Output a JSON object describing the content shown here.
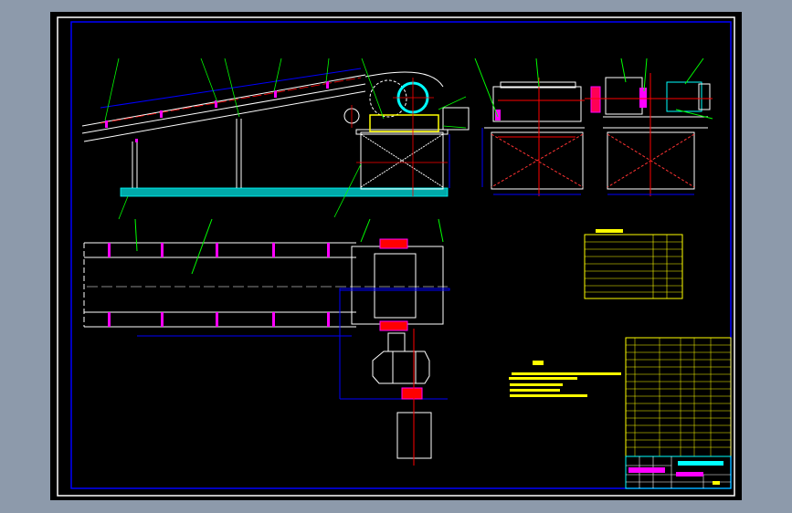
{
  "viewport": {
    "background": "#8d9aab",
    "canvas": "#000000"
  },
  "colors": {
    "frame_outer": "#ffffff",
    "frame_inner": "#0000ff",
    "outline": "#ffffff",
    "centerline": "#ff0000",
    "leader": "#00ff00",
    "dimension": "#0000ff",
    "ground": "#00ffff",
    "motor_drum": "#00ffff",
    "bearing": "#ff00ff",
    "text": "#ffff00",
    "table_lines": "#ffffff"
  },
  "views": [
    "side-elevation",
    "end-view-left",
    "end-view-right",
    "plan-view",
    "drive-plan"
  ],
  "icons": {
    "balloon": "leader-number-balloon"
  }
}
